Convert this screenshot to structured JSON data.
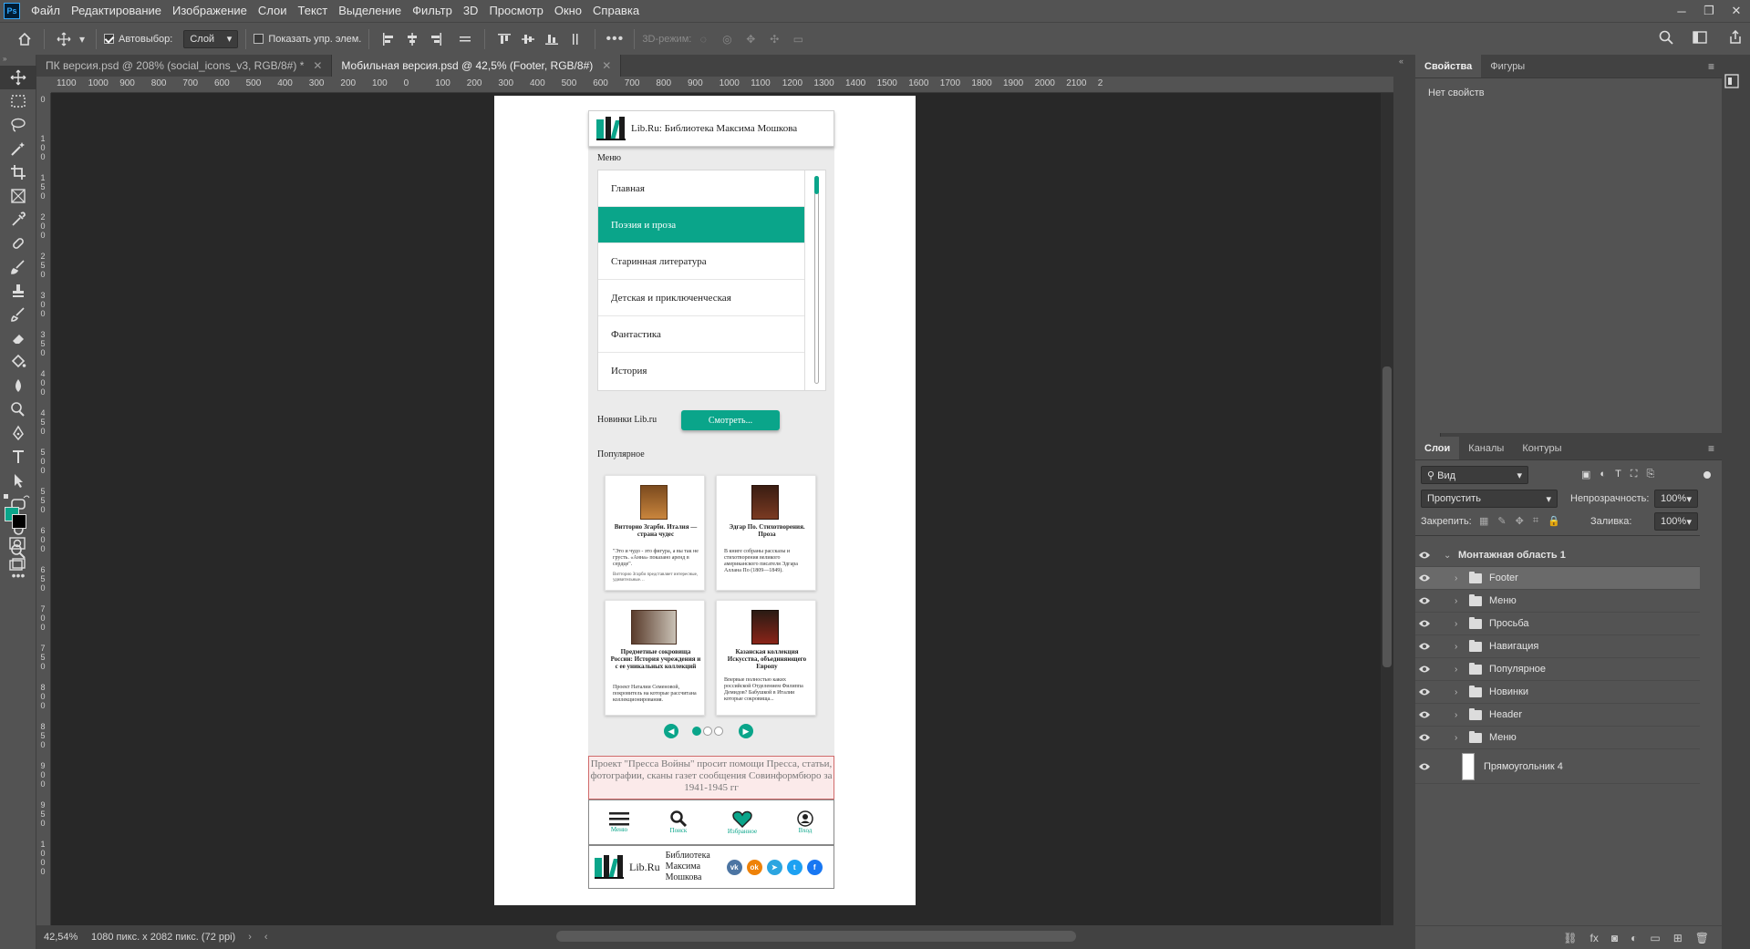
{
  "app": {
    "logo": "Ps"
  },
  "menubar": [
    "Файл",
    "Редактирование",
    "Изображение",
    "Слои",
    "Текст",
    "Выделение",
    "Фильтр",
    "3D",
    "Просмотр",
    "Окно",
    "Справка"
  ],
  "options": {
    "autoselect_label": "Автовыбор:",
    "autoselect_value": "Слой",
    "show_transform_label": "Показать упр. элем.",
    "mode3d_label": "3D-режим:"
  },
  "tabs": [
    {
      "label": "ПК версия.psd @ 208% (social_icons_v3, RGB/8#) *"
    },
    {
      "label": "Мобильная версия.psd @ 42,5% (Footer, RGB/8#)"
    }
  ],
  "ruler_top": [
    "1100",
    "1000",
    "900",
    "800",
    "700",
    "600",
    "500",
    "400",
    "300",
    "200",
    "100",
    "0",
    "100",
    "200",
    "300",
    "400",
    "500",
    "600",
    "700",
    "800",
    "900",
    "1000",
    "1100",
    "1200",
    "1300",
    "1400",
    "1500",
    "1600",
    "1700",
    "1800",
    "1900",
    "2000",
    "2100",
    "2"
  ],
  "ruler_left": [
    "0",
    "1 0 0",
    "1 5 0",
    "2 0 0",
    "2 5 0",
    "3 0 0",
    "3 5 0",
    "4 0 0",
    "4 5 0",
    "5 0 0",
    "5 5 0",
    "6 0 0",
    "6 5 0",
    "7 0 0",
    "7 5 0",
    "8 0 0",
    "8 5 0",
    "9 0 0",
    "9 5 0",
    "1 0 0 0"
  ],
  "status": {
    "zoom": "42,54%",
    "doc": "1080 пикс. x 2082 пикс. (72 ppi)"
  },
  "mockup": {
    "header_title": "Lib.Ru: Библиотека Максима Мошкова",
    "menu_label": "Меню",
    "menu_items": [
      "Главная",
      "Поэзия и проза",
      "Старинная литература",
      "Детская и приключенческая",
      "Фантастика",
      "История"
    ],
    "novelty_label": "Новинки Lib.ru",
    "novelty_button": "Смотреть...",
    "popular_label": "Популярное",
    "cards": [
      {
        "title": "Витторио Згарби. Италия — страна чудес",
        "desc": "\"Это и чудо - это фигура, а вы так не грусть. «Анна» показано аренд в сердце\".",
        "small": "Витторио Згарби представляет интересные, удивительные…"
      },
      {
        "title": "Эдгар По. Стихотворения. Проза",
        "desc": "В книге собраны рассказы и стихотворения великого американского писателя Эдгара Аллана По (1809—1849).",
        "small": ""
      },
      {
        "title": "Предметные сокровища России: История учреждения и с ее уникальных коллекций",
        "desc": "Проект Наталии Семеновой, покровитель на которые рассчитана коллекционирования.",
        "small": ""
      },
      {
        "title": "Казанская коллекция Искусства, объединяющего Европу",
        "desc": "Впервые полностью каких российской Отделением Филиппа Демидов? Бабушкой в Италии которые сокровища...",
        "small": ""
      }
    ],
    "banner_text": "Проект \"Пресса Войны\" просит помощи Пресса, статьи, фотографии, сканы газет сообщения Совинформбюро за 1941-1945 гг",
    "bottom_nav": [
      "Меню",
      "Поиск",
      "Избранное",
      "Вход"
    ],
    "footer_logo": "Lib.Ru",
    "footer_text": "Библиотека Максима Мошкова",
    "socials": [
      {
        "name": "vk",
        "glyph": "vk",
        "color": "#4c75a3"
      },
      {
        "name": "ok",
        "glyph": "ok",
        "color": "#ee8208"
      },
      {
        "name": "telegram",
        "glyph": "➤",
        "color": "#2ca5e0"
      },
      {
        "name": "twitter",
        "glyph": "t",
        "color": "#1da1f2"
      },
      {
        "name": "facebook",
        "glyph": "f",
        "color": "#1877f2"
      }
    ]
  },
  "properties": {
    "tabs": [
      "Свойства",
      "Фигуры"
    ],
    "empty": "Нет свойств"
  },
  "layers_panel": {
    "tabs": [
      "Слои",
      "Каналы",
      "Контуры"
    ],
    "filter": "Вид",
    "blend": "Пропустить",
    "opacity_label": "Непрозрачность:",
    "opacity": "100%",
    "lock_label": "Закрепить:",
    "fill_label": "Заливка:",
    "fill": "100%",
    "artboard": "Монтажная область 1",
    "layers": [
      "Footer",
      "Меню",
      "Просьба",
      "Навигация",
      "Популярное",
      "Новинки",
      "Header",
      "Меню"
    ],
    "shape_layer": "Прямоугольник 4"
  },
  "colors": {
    "accent": "#0aa58a",
    "foreground": "#0aa58a",
    "background": "#000000"
  }
}
